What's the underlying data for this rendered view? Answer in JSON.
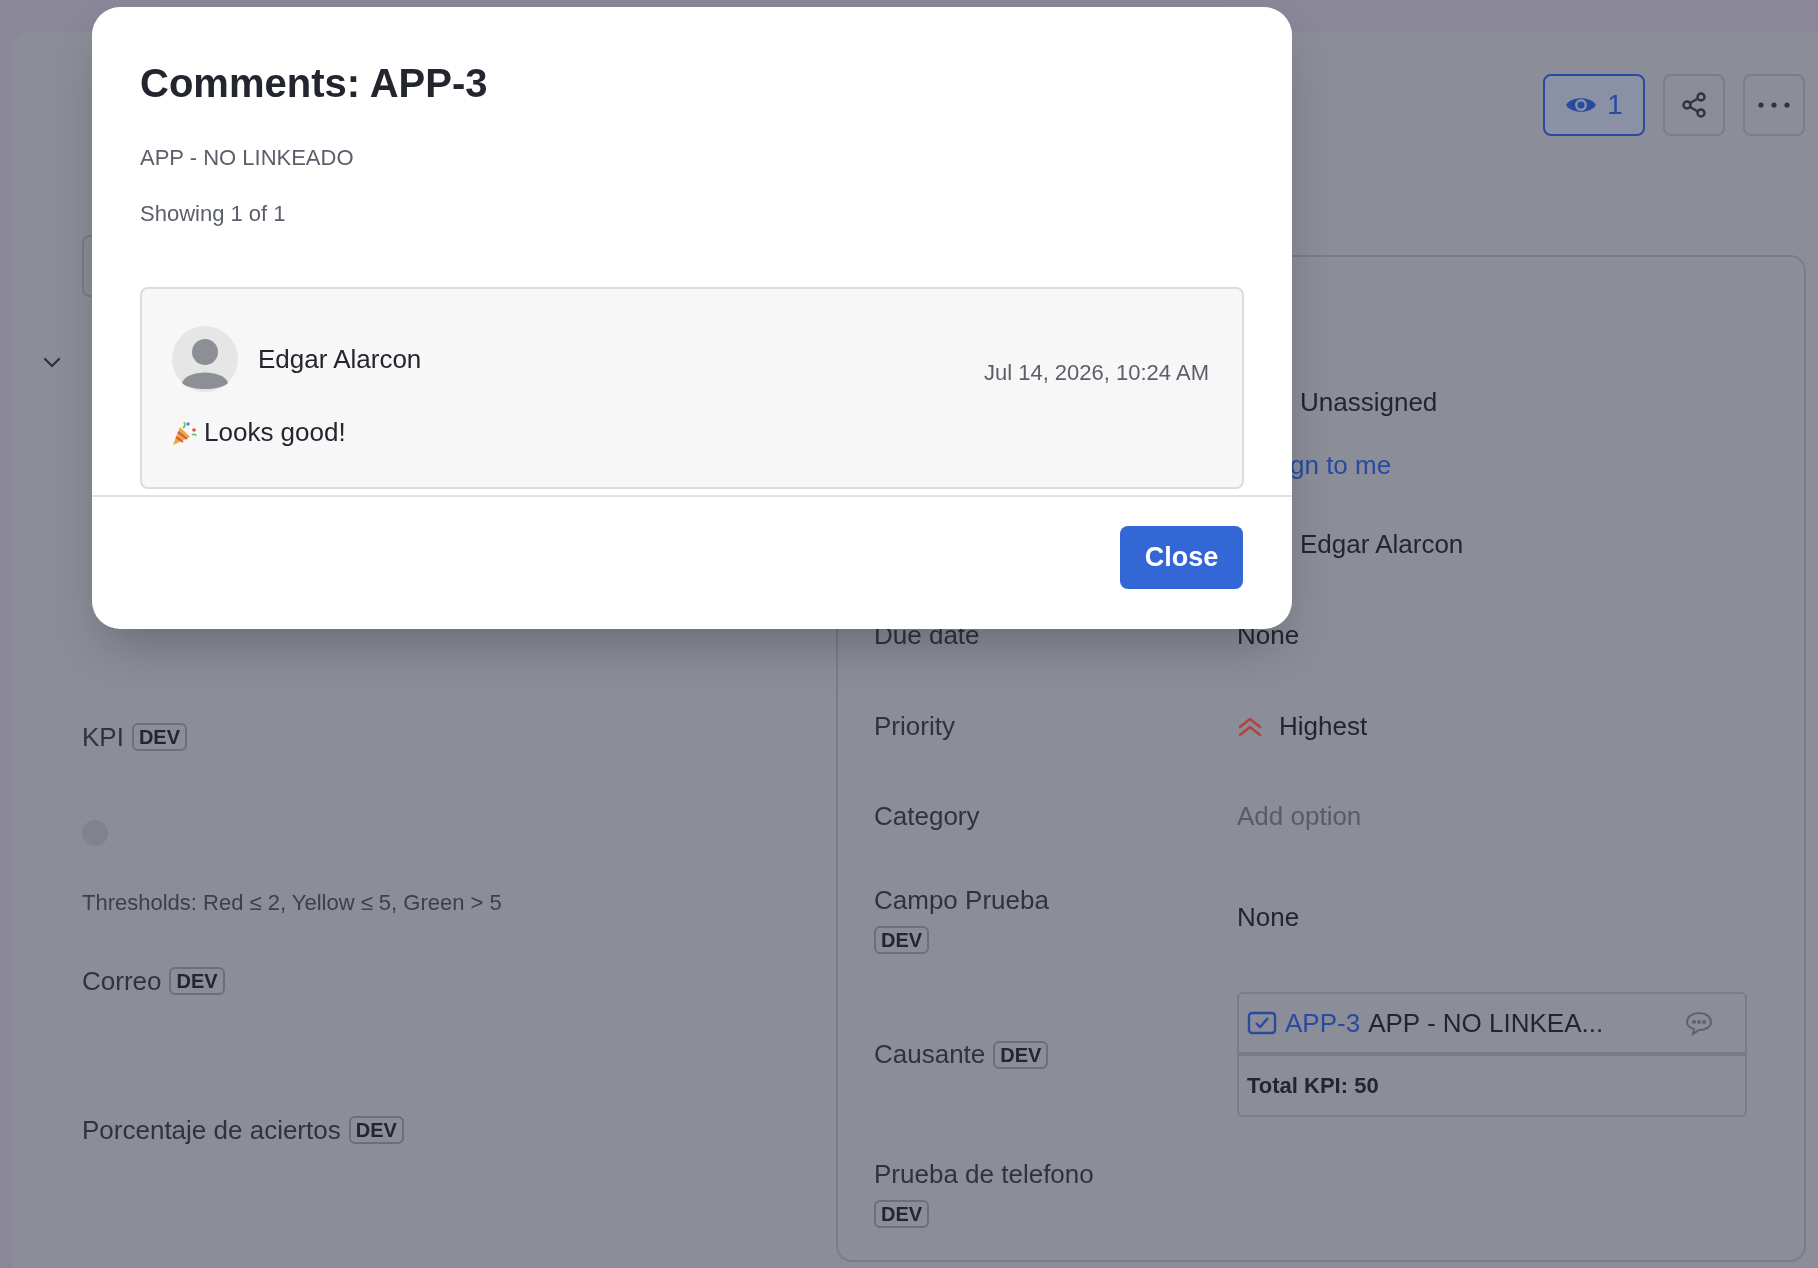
{
  "header_actions": {
    "watchers": "1"
  },
  "left_section": {
    "expanded": true
  },
  "left_fields": [
    {
      "kind": "kpi",
      "label": "KPI",
      "badge": "DEV",
      "color": "#80838c",
      "thresholds": "Thresholds: Red ≤ 2, Yellow ≤ 5, Green > 5"
    },
    {
      "kind": "plain",
      "label": "Correo",
      "badge": "DEV"
    },
    {
      "kind": "plain",
      "label": "Porcentaje de aciertos",
      "badge": "DEV"
    }
  ],
  "details": [
    {
      "kind": "user",
      "value": "Unassigned"
    },
    {
      "kind": "link",
      "value": "gn to me"
    },
    {
      "kind": "user",
      "value": "Edgar Alarcon"
    },
    {
      "kind": "text",
      "label": "Due date",
      "value": "None"
    },
    {
      "kind": "priority",
      "label": "Priority",
      "value": "Highest"
    },
    {
      "kind": "placeholder",
      "label": "Category",
      "placeholder": "Add option"
    },
    {
      "kind": "text",
      "label": "Campo Prueba",
      "badge": "DEV",
      "value": "None"
    },
    {
      "kind": "issue",
      "label": "Causante",
      "badge": "DEV",
      "issue_key": "APP-3",
      "summary": "APP - NO LINKEA...",
      "total": "Total KPI: 50"
    },
    {
      "kind": "empty",
      "label": "Prueba de telefono",
      "badge": "DEV"
    }
  ],
  "modal": {
    "title": "Comments: APP-3",
    "subtitle": "APP - NO LINKEADO",
    "count": "Showing 1 of 1",
    "comments": [
      {
        "author": "Edgar Alarcon",
        "time": "Jul 14, 2026, 10:24 AM",
        "text": "Looks good!"
      }
    ],
    "close_label": "Close"
  }
}
